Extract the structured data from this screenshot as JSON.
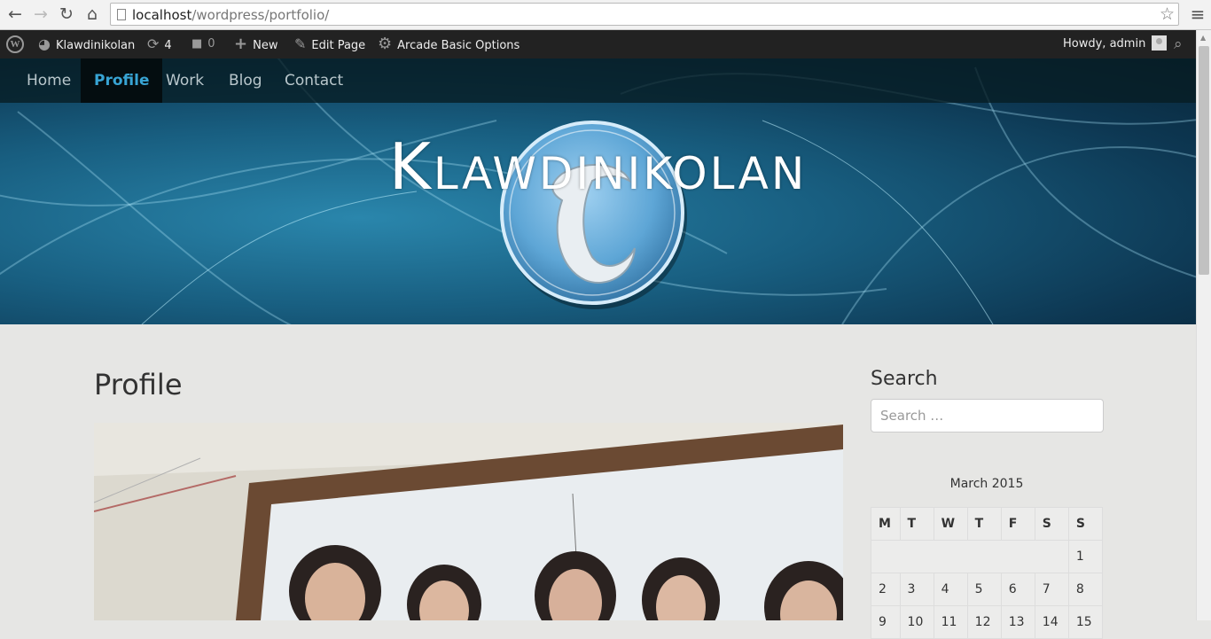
{
  "browser": {
    "url_host": "localhost",
    "url_path": "/wordpress/portfolio/",
    "back_glyph": "←",
    "forward_glyph": "→",
    "reload_glyph": "↻",
    "home_glyph": "⌂",
    "star_glyph": "☆",
    "menu_glyph": "≡"
  },
  "admin_bar": {
    "site_name": "Klawdinikolan",
    "updates_count": "4",
    "comments_count": "0",
    "new_label": "New",
    "edit_page_label": "Edit Page",
    "options_label": "Arcade Basic Options",
    "howdy_label": "Howdy, admin",
    "icons": {
      "wp": "W",
      "site": "◕",
      "updates": "⟳",
      "comments": "■",
      "new": "+",
      "edit": "✎",
      "options": "⚙",
      "search": "⌕"
    }
  },
  "nav": {
    "items": [
      {
        "label": "Home"
      },
      {
        "label": "Profile",
        "active": true
      },
      {
        "label": "Work"
      },
      {
        "label": "Blog"
      },
      {
        "label": "Contact"
      }
    ]
  },
  "header": {
    "site_title": "Klawdinikolan"
  },
  "main": {
    "page_title": "Profile"
  },
  "sidebar": {
    "search_title": "Search",
    "search_placeholder": "Search …",
    "calendar": {
      "caption": "March 2015",
      "headers": [
        "M",
        "T",
        "W",
        "T",
        "F",
        "S",
        "S"
      ],
      "rows": [
        [
          "",
          "",
          "",
          "",
          "",
          "",
          "1"
        ],
        [
          "2",
          "3",
          "4",
          "5",
          "6",
          "7",
          "8"
        ],
        [
          "9",
          "10",
          "11",
          "12",
          "13",
          "14",
          "15"
        ]
      ]
    }
  },
  "colors": {
    "accent": "#38a4d4",
    "admin_bar": "#222222",
    "header_blue": "#185e80"
  }
}
